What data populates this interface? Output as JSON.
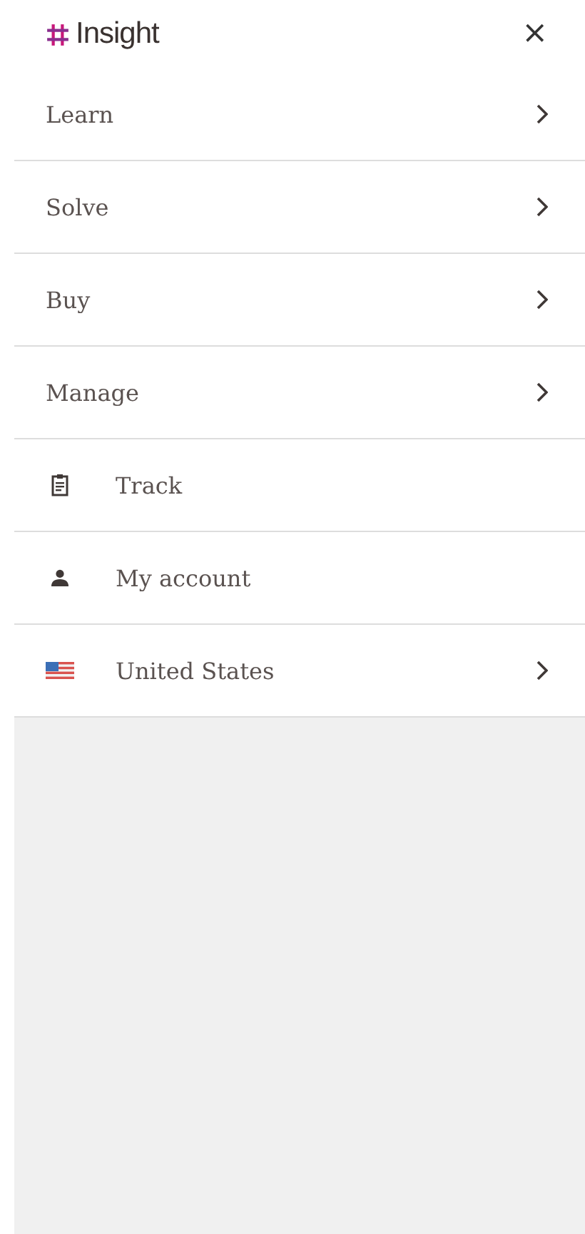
{
  "header": {
    "logo": "Insight",
    "close": "×"
  },
  "menu": [
    {
      "kind": "plain",
      "label": "Learn",
      "expandable": true
    },
    {
      "kind": "plain",
      "label": "Solve",
      "expandable": true
    },
    {
      "kind": "plain",
      "label": "Buy",
      "expandable": true
    },
    {
      "kind": "plain",
      "label": "Manage",
      "expandable": true
    },
    {
      "kind": "clipboard",
      "label": "Track",
      "expandable": false
    },
    {
      "kind": "person",
      "label": "My account",
      "expandable": false
    },
    {
      "kind": "flag",
      "label": "United States",
      "expandable": true
    }
  ]
}
